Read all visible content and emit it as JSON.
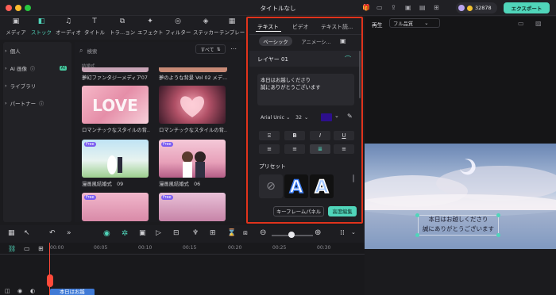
{
  "window": {
    "title": "タイトルなし",
    "credits": "32878",
    "export_label": "エクスポート"
  },
  "toolbar": {
    "items": [
      {
        "label": "メディア",
        "icon": "media-icon"
      },
      {
        "label": "ストック",
        "icon": "stock-icon"
      },
      {
        "label": "オーディオ",
        "icon": "music-icon"
      },
      {
        "label": "タイトル",
        "icon": "title-icon"
      },
      {
        "label": "トラ...ョン",
        "icon": "transition-icon"
      },
      {
        "label": "エフェクト",
        "icon": "effect-icon"
      },
      {
        "label": "フィルター",
        "icon": "filter-icon"
      },
      {
        "label": "ステッカー",
        "icon": "sticker-icon"
      },
      {
        "label": "テンプレー",
        "icon": "template-icon"
      }
    ]
  },
  "sidebar": {
    "items": [
      {
        "label": "個人"
      },
      {
        "label": "AI 画像",
        "badge": "AI"
      },
      {
        "label": "ライブラリ"
      },
      {
        "label": "パートナー"
      }
    ]
  },
  "media": {
    "search_placeholder": "検索",
    "filter_label": "すべて",
    "section_label": "結婚式",
    "top_captions": [
      "夢幻ファンタジーメディア07",
      "夢のような背景 Vol 02 メデ..."
    ],
    "items": [
      {
        "caption": "ロマンチックなスタイルの背...",
        "free": false
      },
      {
        "caption": "ロマンチックなスタイルの背...",
        "free": false
      },
      {
        "caption": "漫画風結婚式　09",
        "free": true
      },
      {
        "caption": "漫画風結婚式　06",
        "free": true
      },
      {
        "caption": "",
        "free": true
      },
      {
        "caption": "",
        "free": true
      }
    ],
    "free_label": "Free"
  },
  "props": {
    "tabs": [
      "テキスト",
      "ビデオ",
      "テキスト読..."
    ],
    "subtabs": [
      "ベーシック",
      "アニメーシ..."
    ],
    "layer_label": "レイヤー 01",
    "text_lines": [
      "本日はお越しくださり",
      "誠にありがとうございます"
    ],
    "font": "Arial Unic",
    "size": "32",
    "color": "#2d0f8c",
    "format_row1": [
      "B",
      "I",
      "U"
    ],
    "preset_label": "プリセット",
    "keyframe_label": "キーフレームパネル",
    "advanced_label": "高度編集"
  },
  "preview": {
    "label": "再生",
    "quality": "フル品質",
    "caption_lines": [
      "本日はお越しくださり",
      "誠にありがとうございます"
    ]
  },
  "timeline": {
    "ruler": [
      "00:00",
      "00:05",
      "00:10",
      "00:15",
      "00:20",
      "00:25",
      "00:30"
    ],
    "clip_label": "本日はお越"
  }
}
